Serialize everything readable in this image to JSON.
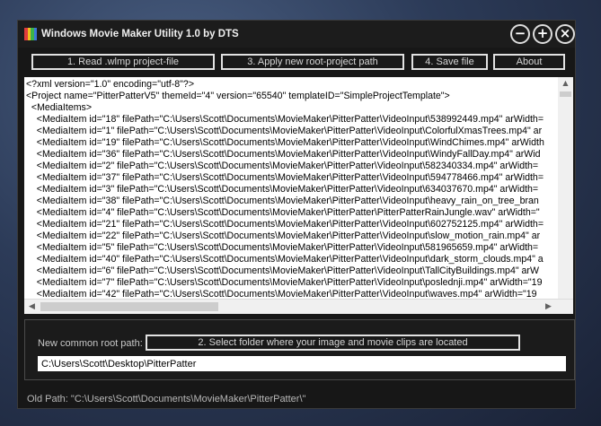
{
  "window": {
    "title": "Windows Movie Maker Utility 1.0 by DTS",
    "controls": {
      "minimize": "−",
      "maximize": "+",
      "close": "×"
    }
  },
  "toolbar": {
    "read_label": "1. Read .wlmp project-file",
    "apply_label": "3. Apply new root-project path",
    "save_label": "4. Save file",
    "about_label": "About"
  },
  "xml_view": {
    "lines": [
      "<?xml version=\"1.0\" encoding=\"utf-8\"?>",
      "<Project name=\"PitterPatterV5\" themeId=\"4\" version=\"65540\" templateID=\"SimpleProjectTemplate\">",
      "  <MediaItems>",
      "    <MediaItem id=\"18\" filePath=\"C:\\Users\\Scott\\Documents\\MovieMaker\\PitterPatter\\VideoInput\\538992449.mp4\" arWidth=",
      "    <MediaItem id=\"1\" filePath=\"C:\\Users\\Scott\\Documents\\MovieMaker\\PitterPatter\\VideoInput\\ColorfulXmasTrees.mp4\" ar",
      "    <MediaItem id=\"19\" filePath=\"C:\\Users\\Scott\\Documents\\MovieMaker\\PitterPatter\\VideoInput\\WindChimes.mp4\" arWidth",
      "    <MediaItem id=\"36\" filePath=\"C:\\Users\\Scott\\Documents\\MovieMaker\\PitterPatter\\VideoInput\\WindyFallDay.mp4\" arWid",
      "    <MediaItem id=\"2\" filePath=\"C:\\Users\\Scott\\Documents\\MovieMaker\\PitterPatter\\VideoInput\\582340334.mp4\" arWidth=",
      "    <MediaItem id=\"37\" filePath=\"C:\\Users\\Scott\\Documents\\MovieMaker\\PitterPatter\\VideoInput\\594778466.mp4\" arWidth=",
      "    <MediaItem id=\"3\" filePath=\"C:\\Users\\Scott\\Documents\\MovieMaker\\PitterPatter\\VideoInput\\634037670.mp4\" arWidth=",
      "    <MediaItem id=\"38\" filePath=\"C:\\Users\\Scott\\Documents\\MovieMaker\\PitterPatter\\VideoInput\\heavy_rain_on_tree_bran",
      "    <MediaItem id=\"4\" filePath=\"C:\\Users\\Scott\\Documents\\MovieMaker\\PitterPatter\\PitterPatterRainJungle.wav\" arWidth=\"",
      "    <MediaItem id=\"21\" filePath=\"C:\\Users\\Scott\\Documents\\MovieMaker\\PitterPatter\\VideoInput\\602752125.mp4\" arWidth=",
      "    <MediaItem id=\"22\" filePath=\"C:\\Users\\Scott\\Documents\\MovieMaker\\PitterPatter\\VideoInput\\slow_motion_rain.mp4\" ar",
      "    <MediaItem id=\"5\" filePath=\"C:\\Users\\Scott\\Documents\\MovieMaker\\PitterPatter\\VideoInput\\581965659.mp4\" arWidth=",
      "    <MediaItem id=\"40\" filePath=\"C:\\Users\\Scott\\Documents\\MovieMaker\\PitterPatter\\VideoInput\\dark_storm_clouds.mp4\" a",
      "    <MediaItem id=\"6\" filePath=\"C:\\Users\\Scott\\Documents\\MovieMaker\\PitterPatter\\VideoInput\\TallCityBuildings.mp4\" arW",
      "    <MediaItem id=\"7\" filePath=\"C:\\Users\\Scott\\Documents\\MovieMaker\\PitterPatter\\VideoInput\\poslednji.mp4\" arWidth=\"19",
      "    <MediaItem id=\"42\" filePath=\"C:\\Users\\Scott\\Documents\\MovieMaker\\PitterPatter\\VideoInput\\waves.mp4\" arWidth=\"19"
    ],
    "scroll_up": "▲",
    "scroll_left": "◀",
    "scroll_right": "▶"
  },
  "root_path": {
    "label": "New common root path:",
    "select_folder_label": "2. Select folder where your image and movie clips are located",
    "value": "C:\\Users\\Scott\\Desktop\\PitterPatter"
  },
  "status": {
    "old_path": "Old Path: \"C:\\Users\\Scott\\Documents\\MovieMaker\\PitterPatter\\\""
  },
  "colors": {
    "window_bg": "#171717",
    "button_border": "#e2e2e2",
    "icon_stripes": [
      "#e03c3c",
      "#f0c020",
      "#3cb34a",
      "#3c78d8"
    ]
  }
}
